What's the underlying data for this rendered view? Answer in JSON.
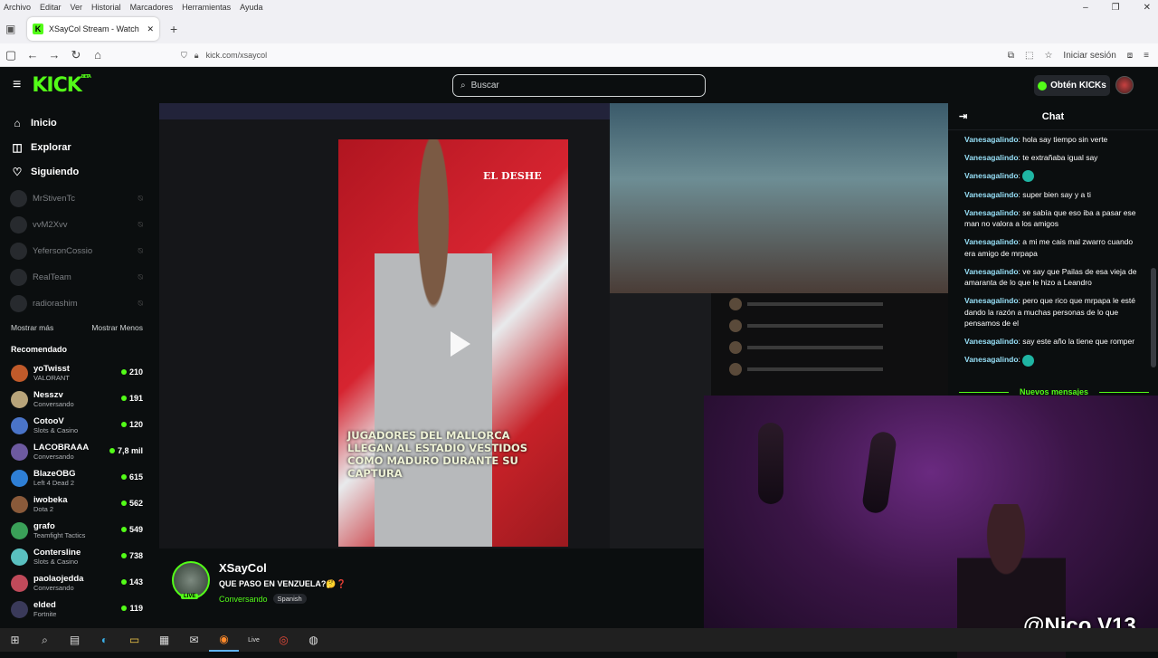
{
  "browser": {
    "menu": [
      "Archivo",
      "Editar",
      "Ver",
      "Historial",
      "Marcadores",
      "Herramientas",
      "Ayuda"
    ],
    "tab_title": "XSayCol Stream - Watch Liv",
    "url": "kick.com/xsaycol",
    "signin": "Iniciar sesión"
  },
  "header": {
    "logo": "KICK",
    "logo_beta": "BETA",
    "search_placeholder": "Buscar",
    "get_kicks": "Obtén KICKs"
  },
  "sidebar": {
    "nav": [
      {
        "label": "Inicio",
        "icon": "home-icon"
      },
      {
        "label": "Explorar",
        "icon": "compass-icon"
      },
      {
        "label": "Siguiendo",
        "icon": "heart-icon"
      }
    ],
    "following": [
      "MrStivenTc",
      "vvM2Xvv",
      "YefersonCossio",
      "RealTeam",
      "radiorashim"
    ],
    "show_more": "Mostrar más",
    "show_less": "Mostrar Menos",
    "recommended_title": "Recomendado",
    "recommended": [
      {
        "name": "yoTwisst",
        "category": "VALORANT",
        "viewers": "210",
        "color": "#c05a2a"
      },
      {
        "name": "Nesszv",
        "category": "Conversando",
        "viewers": "191",
        "color": "#b8a47a"
      },
      {
        "name": "CotooV",
        "category": "Slots & Casino",
        "viewers": "120",
        "color": "#4a74c8"
      },
      {
        "name": "LACOBRAAA",
        "category": "Conversando",
        "viewers": "7,8 mil",
        "color": "#6d5aa0"
      },
      {
        "name": "BlazeOBG",
        "category": "Left 4 Dead 2",
        "viewers": "615",
        "color": "#2e7fd6"
      },
      {
        "name": "iwobeka",
        "category": "Dota 2",
        "viewers": "562",
        "color": "#8a5a3a"
      },
      {
        "name": "grafo",
        "category": "Teamfight Tactics",
        "viewers": "549",
        "color": "#3aa058"
      },
      {
        "name": "Contersline",
        "category": "Slots & Casino",
        "viewers": "738",
        "color": "#5ac0c0"
      },
      {
        "name": "paolaojedda",
        "category": "Conversando",
        "viewers": "143",
        "color": "#c04a5a"
      },
      {
        "name": "elded",
        "category": "Fortnite",
        "viewers": "119",
        "color": "#3a3a5a"
      }
    ]
  },
  "player": {
    "caption": "JUGADORES DEL MALLORCA LLEGAN AL ESTADIO VESTIDOS COMO MADURO DURANTE SU CAPTURA",
    "overlay_top": "EL DESHE"
  },
  "stream": {
    "name": "XSayCol",
    "title": "QUE PASO EN VENZUELA?🤔❓",
    "category": "Conversando",
    "language": "Spanish",
    "live": "LIVE",
    "watermark": "@Nico.V13"
  },
  "chat": {
    "title": "Chat",
    "new_messages": "Nuevos mensajes",
    "messages": [
      {
        "user": "Vanesagalindo",
        "text": "hola say tiempo sin verte"
      },
      {
        "user": "Vanesagalindo",
        "text": "te extrañaba igual say"
      },
      {
        "user": "Vanesagalindo",
        "text": "",
        "emoji": true
      },
      {
        "user": "Vanesagalindo",
        "text": "super bien say y a ti"
      },
      {
        "user": "Vanesagalindo",
        "text": "se sabía que eso iba a pasar ese man no valora a los amigos"
      },
      {
        "user": "Vanesagalindo",
        "text": "a mi me cais mal zwarro cuando era amigo de mrpapa"
      },
      {
        "user": "Vanesagalindo",
        "text": "ve say que Pailas de esa vieja de amaranta de lo que le hizo a Leandro"
      },
      {
        "user": "Vanesagalindo",
        "text": "pero que rico que mrpapa le esté dando la razón a muchas personas de lo que pensamos de el"
      },
      {
        "user": "Vanesagalindo",
        "text": "say este año la tiene que romper"
      },
      {
        "user": "Vanesagalindo",
        "text": "",
        "emoji": true
      }
    ]
  },
  "taskbar": [
    "windows-icon",
    "search-icon",
    "taskview-icon",
    "edge-icon",
    "explorer-icon",
    "store-icon",
    "mail-icon",
    "firefox-icon",
    "live-icon",
    "chrome-icon",
    "obs-icon"
  ]
}
